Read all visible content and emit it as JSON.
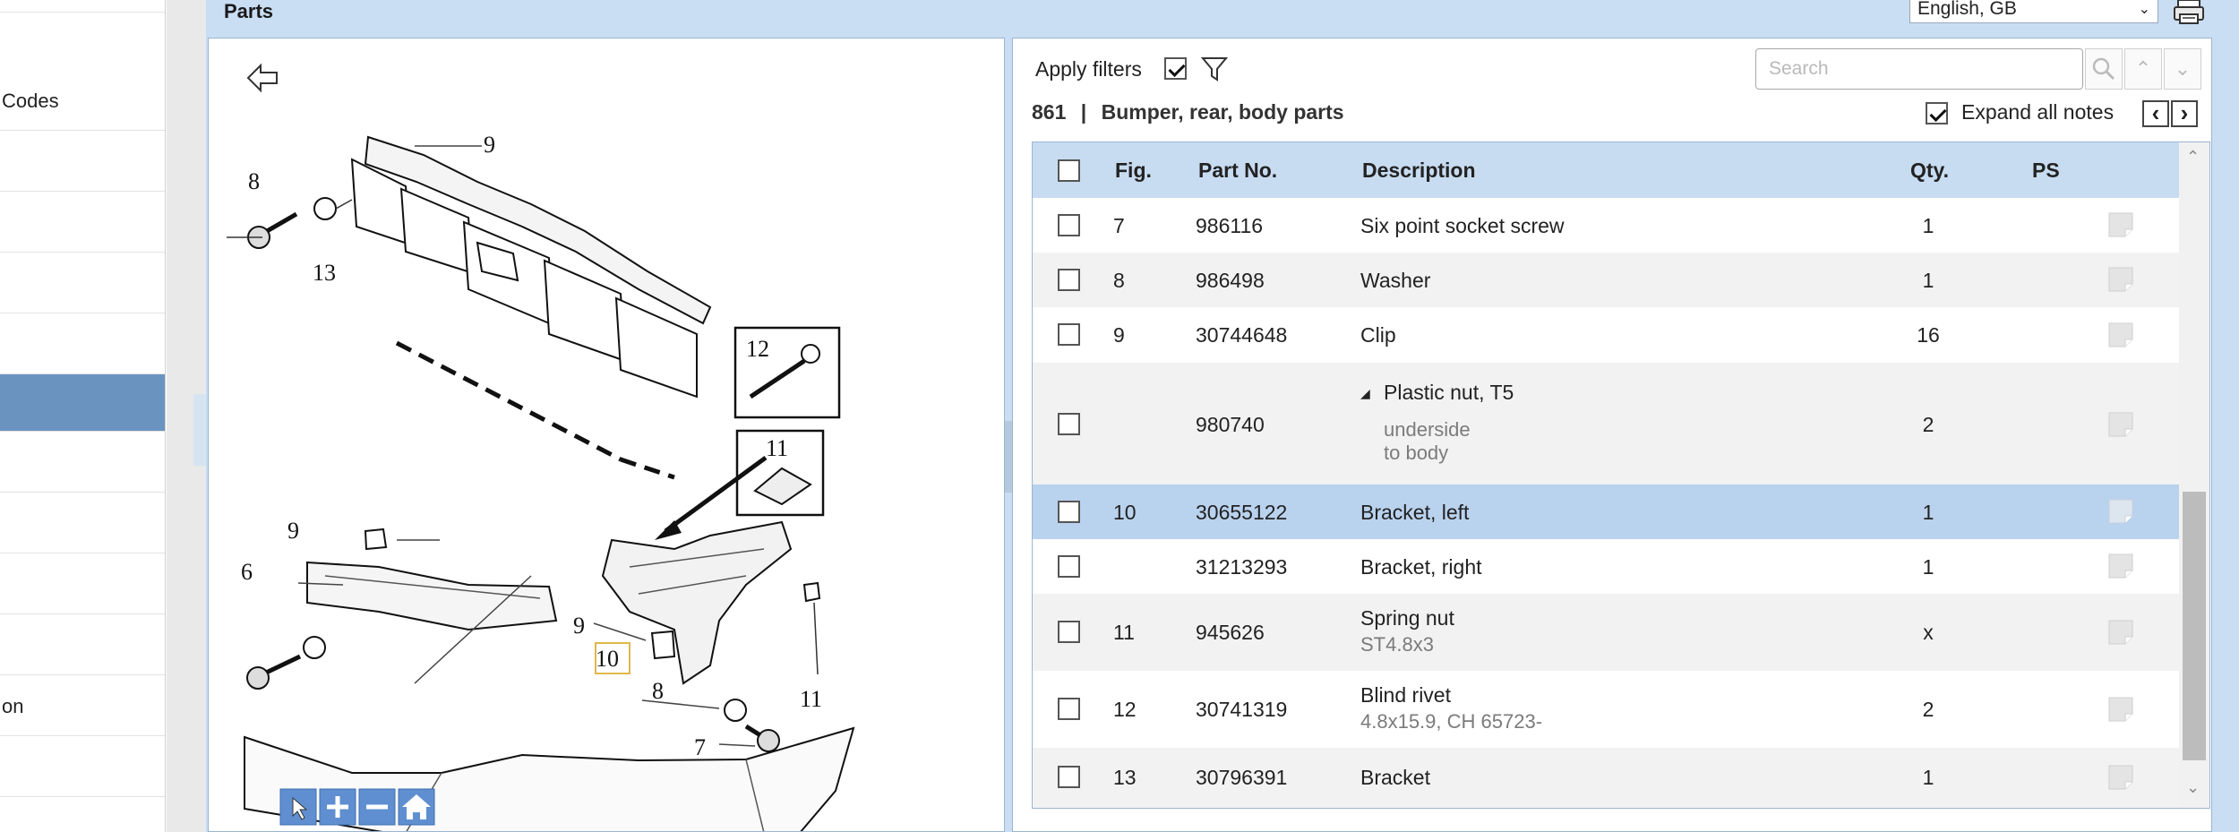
{
  "sidebar": {
    "items": [
      "",
      "Codes",
      "",
      "",
      "",
      "",
      "",
      "",
      "",
      "",
      "",
      "on",
      ""
    ]
  },
  "panel": {
    "title": "Parts",
    "language": "English, GB"
  },
  "toolbar": {
    "apply_filters_label": "Apply filters",
    "apply_filters_checked": true,
    "search_placeholder": "Search",
    "expand_notes_label": "Expand all notes",
    "expand_notes_checked": true,
    "prev_label": "‹",
    "next_label": "›"
  },
  "section": {
    "number": "861",
    "separator": "|",
    "name": "Bumper, rear, body parts"
  },
  "table": {
    "columns": [
      "Fig.",
      "Part No.",
      "Description",
      "Qty.",
      "PS"
    ],
    "rows": [
      {
        "fig": "7",
        "part": "986116",
        "desc": "Six point socket screw",
        "note": "",
        "qty": "1"
      },
      {
        "fig": "8",
        "part": "986498",
        "desc": "Washer",
        "note": "",
        "qty": "1"
      },
      {
        "fig": "9",
        "part": "30744648",
        "desc": "Clip",
        "note": "",
        "qty": "16"
      },
      {
        "fig": "",
        "part": "980740",
        "desc": "Plastic nut, T5",
        "note": "underside",
        "note2": "to body",
        "qty": "2"
      },
      {
        "fig": "10",
        "part": "30655122",
        "desc": "Bracket, left",
        "note": "",
        "qty": "1"
      },
      {
        "fig": "",
        "part": "31213293",
        "desc": "Bracket, right",
        "note": "",
        "qty": "1"
      },
      {
        "fig": "11",
        "part": "945626",
        "desc": "Spring nut",
        "note": "ST4.8x3",
        "qty": "x"
      },
      {
        "fig": "12",
        "part": "30741319",
        "desc": "Blind rivet",
        "note": "4.8x15.9, CH 65723-",
        "qty": "2"
      },
      {
        "fig": "13",
        "part": "30796391",
        "desc": "Bracket",
        "note": "",
        "qty": "1"
      }
    ]
  },
  "diagram": {
    "callouts": [
      "9",
      "8",
      "13",
      "12",
      "11",
      "9",
      "6",
      "9",
      "10",
      "8",
      "7",
      "11"
    ]
  },
  "colors": {
    "panel_bg": "#c9ddf3",
    "header_bg": "#c8dcf1",
    "selected_row": "#b9d2ee",
    "sidebar_active": "#6b93bf"
  }
}
